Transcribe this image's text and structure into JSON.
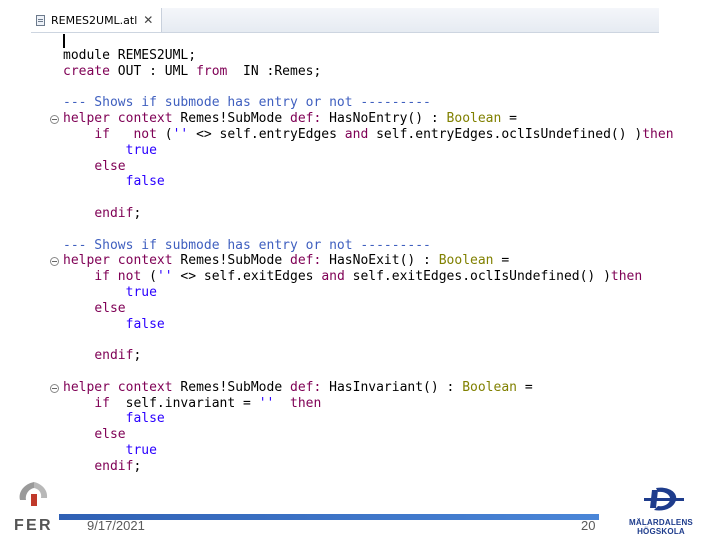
{
  "editor": {
    "tab": {
      "label": "REMES2UML.atl",
      "close_icon": "close-icon"
    },
    "code_lines": [
      [
        {
          "t": "module REMES2UML;",
          "c": ""
        }
      ],
      [
        {
          "t": "create",
          "c": "kw"
        },
        {
          "t": " OUT : UML ",
          "c": ""
        },
        {
          "t": "from",
          "c": "kw"
        },
        {
          "t": "  IN :Remes;",
          "c": ""
        }
      ],
      [],
      [
        {
          "t": "--- Shows if submode has entry or not ---------",
          "c": "cm"
        }
      ],
      [
        {
          "t": "helper",
          "c": "kw"
        },
        {
          "t": " ",
          "c": ""
        },
        {
          "t": "context",
          "c": "kw"
        },
        {
          "t": " Remes!SubMode ",
          "c": ""
        },
        {
          "t": "def:",
          "c": "kw"
        },
        {
          "t": " HasNoEntry() : ",
          "c": ""
        },
        {
          "t": "Boolean",
          "c": "ty"
        },
        {
          "t": " =",
          "c": ""
        }
      ],
      [
        {
          "t": "    ",
          "c": ""
        },
        {
          "t": "if",
          "c": "kw"
        },
        {
          "t": "   ",
          "c": ""
        },
        {
          "t": "not",
          "c": "kw"
        },
        {
          "t": " (",
          "c": ""
        },
        {
          "t": "''",
          "c": "lit"
        },
        {
          "t": " <> self.entryEdges ",
          "c": ""
        },
        {
          "t": "and",
          "c": "kw"
        },
        {
          "t": " self.entryEdges.oclIsUndefined() )",
          "c": ""
        },
        {
          "t": "then",
          "c": "kw"
        }
      ],
      [
        {
          "t": "        ",
          "c": ""
        },
        {
          "t": "true",
          "c": "lit"
        }
      ],
      [
        {
          "t": "    ",
          "c": ""
        },
        {
          "t": "else",
          "c": "kw"
        }
      ],
      [
        {
          "t": "        ",
          "c": ""
        },
        {
          "t": "false",
          "c": "lit"
        }
      ],
      [],
      [
        {
          "t": "    ",
          "c": ""
        },
        {
          "t": "endif",
          "c": "kw"
        },
        {
          "t": ";",
          "c": ""
        }
      ],
      [],
      [
        {
          "t": "--- Shows if submode has entry or not ---------",
          "c": "cm"
        }
      ],
      [
        {
          "t": "helper",
          "c": "kw"
        },
        {
          "t": " ",
          "c": ""
        },
        {
          "t": "context",
          "c": "kw"
        },
        {
          "t": " Remes!SubMode ",
          "c": ""
        },
        {
          "t": "def:",
          "c": "kw"
        },
        {
          "t": " HasNoExit() : ",
          "c": ""
        },
        {
          "t": "Boolean",
          "c": "ty"
        },
        {
          "t": " =",
          "c": ""
        }
      ],
      [
        {
          "t": "    ",
          "c": ""
        },
        {
          "t": "if",
          "c": "kw"
        },
        {
          "t": " ",
          "c": ""
        },
        {
          "t": "not",
          "c": "kw"
        },
        {
          "t": " (",
          "c": ""
        },
        {
          "t": "''",
          "c": "lit"
        },
        {
          "t": " <> self.exitEdges ",
          "c": ""
        },
        {
          "t": "and",
          "c": "kw"
        },
        {
          "t": " self.exitEdges.oclIsUndefined() )",
          "c": ""
        },
        {
          "t": "then",
          "c": "kw"
        }
      ],
      [
        {
          "t": "        ",
          "c": ""
        },
        {
          "t": "true",
          "c": "lit"
        }
      ],
      [
        {
          "t": "    ",
          "c": ""
        },
        {
          "t": "else",
          "c": "kw"
        }
      ],
      [
        {
          "t": "        ",
          "c": ""
        },
        {
          "t": "false",
          "c": "lit"
        }
      ],
      [],
      [
        {
          "t": "    ",
          "c": ""
        },
        {
          "t": "endif",
          "c": "kw"
        },
        {
          "t": ";",
          "c": ""
        }
      ],
      [],
      [
        {
          "t": "helper",
          "c": "kw"
        },
        {
          "t": " ",
          "c": ""
        },
        {
          "t": "context",
          "c": "kw"
        },
        {
          "t": " Remes!SubMode ",
          "c": ""
        },
        {
          "t": "def:",
          "c": "kw"
        },
        {
          "t": " HasInvariant() : ",
          "c": ""
        },
        {
          "t": "Boolean",
          "c": "ty"
        },
        {
          "t": " =",
          "c": ""
        }
      ],
      [
        {
          "t": "    ",
          "c": ""
        },
        {
          "t": "if",
          "c": "kw"
        },
        {
          "t": "  self.invariant = ",
          "c": ""
        },
        {
          "t": "''",
          "c": "lit"
        },
        {
          "t": "  ",
          "c": ""
        },
        {
          "t": "then",
          "c": "kw"
        }
      ],
      [
        {
          "t": "        ",
          "c": ""
        },
        {
          "t": "false",
          "c": "lit"
        }
      ],
      [
        {
          "t": "    ",
          "c": ""
        },
        {
          "t": "else",
          "c": "kw"
        }
      ],
      [
        {
          "t": "        ",
          "c": ""
        },
        {
          "t": "true",
          "c": "lit"
        }
      ],
      [
        {
          "t": "    ",
          "c": ""
        },
        {
          "t": "endif",
          "c": "kw"
        },
        {
          "t": ";",
          "c": ""
        }
      ]
    ],
    "fold_markers_at_lines": [
      4,
      13,
      21
    ]
  },
  "footer": {
    "date": "9/17/2021",
    "page_number": "20"
  },
  "logos": {
    "left": "FER",
    "right": "MÄLARDALENS HÖGSKOLA"
  },
  "colors": {
    "keyword": "#7f0055",
    "comment": "#3f5fbf",
    "type": "#808000",
    "literal": "#2a00ff",
    "footer_bar": "#2f60b4"
  }
}
